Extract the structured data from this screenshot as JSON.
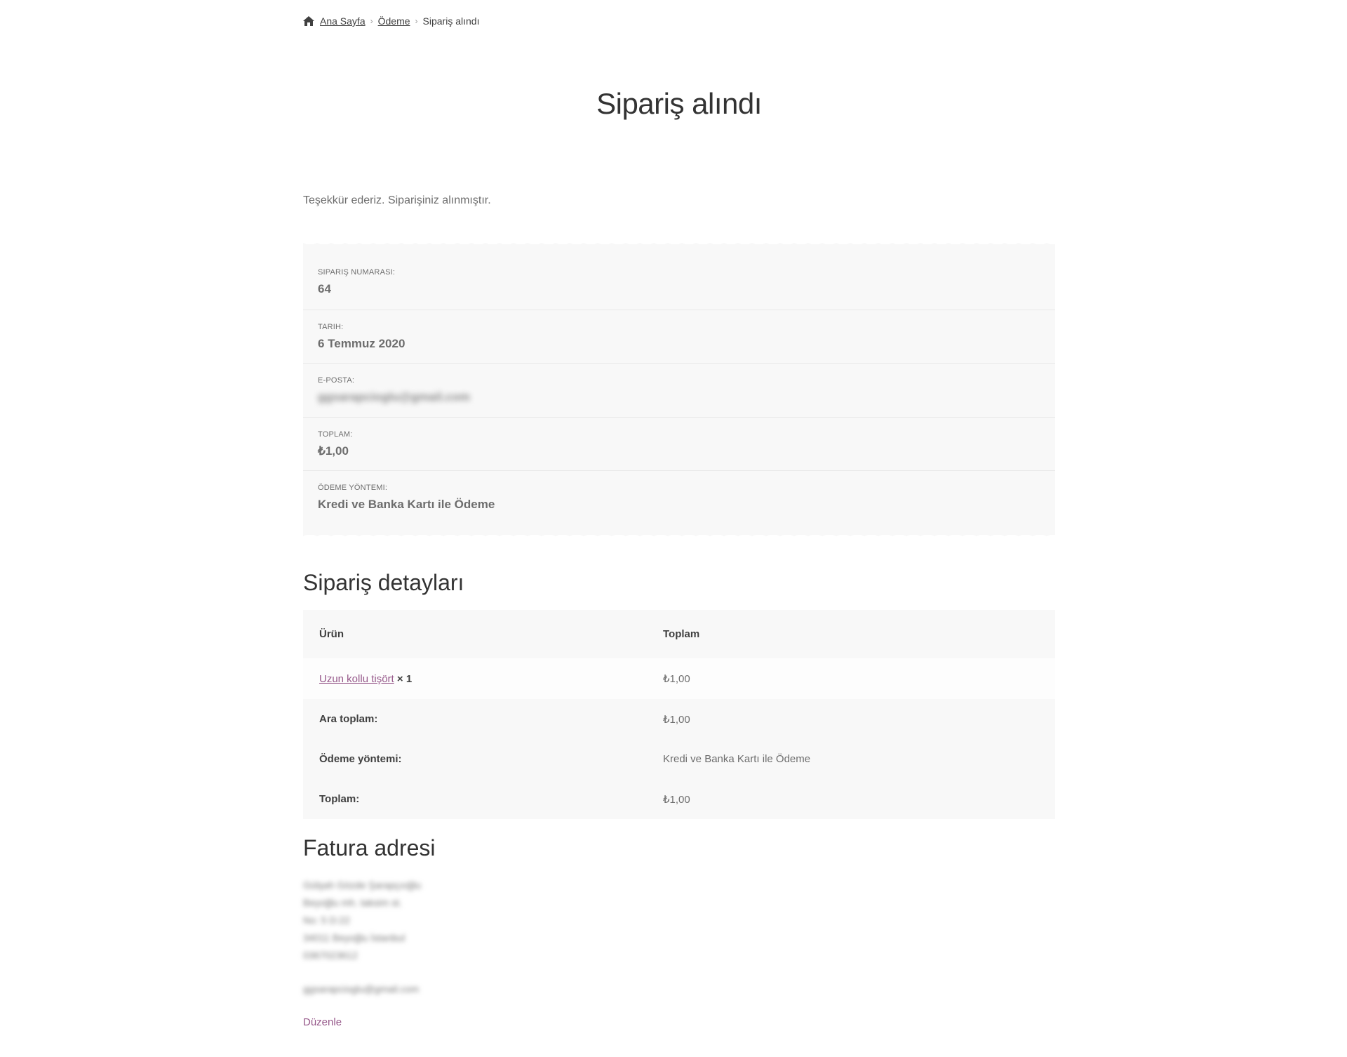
{
  "breadcrumb": {
    "home": "Ana Sayfa",
    "checkout": "Ödeme",
    "current": "Sipariş alındı"
  },
  "page_title": "Sipariş alındı",
  "thank_you": "Teşekkür ederiz. Siparişiniz alınmıştır.",
  "overview": {
    "order_number": {
      "label": "Sipariş numarası:",
      "value": "64"
    },
    "date": {
      "label": "Tarih:",
      "value": "6 Temmuz 2020"
    },
    "email": {
      "label": "E-posta:",
      "value": "ggsarapcioglu@gmail.com"
    },
    "total": {
      "label": "Toplam:",
      "value": "₺1,00"
    },
    "payment_method": {
      "label": "Ödeme yöntemi:",
      "value": "Kredi ve Banka Kartı ile Ödeme"
    }
  },
  "details": {
    "title": "Sipariş detayları",
    "header": {
      "product": "Ürün",
      "total": "Toplam"
    },
    "items": [
      {
        "name": "Uzun kollu tişört",
        "qty": "× 1",
        "total": "₺1,00"
      }
    ],
    "footer": [
      {
        "label": "Ara toplam:",
        "value": "₺1,00"
      },
      {
        "label": "Ödeme yöntemi:",
        "value": "Kredi ve Banka Kartı ile Ödeme"
      },
      {
        "label": "Toplam:",
        "value": "₺1,00"
      }
    ]
  },
  "billing": {
    "title": "Fatura adresi",
    "lines": [
      "Gülşah Gözde Şarapçıoğlu",
      "Beyoğlu mh. taksim st.",
      "No: 5 D:22",
      "34011 Beyoğlu İstanbul",
      "0367023612"
    ],
    "email": "ggsarapcioglu@gmail.com",
    "edit": "Düzenle"
  },
  "colors": {
    "accent": "#96588a",
    "panel": "#f8f8f8",
    "text": "#6d6d6d",
    "heading": "#333333"
  }
}
